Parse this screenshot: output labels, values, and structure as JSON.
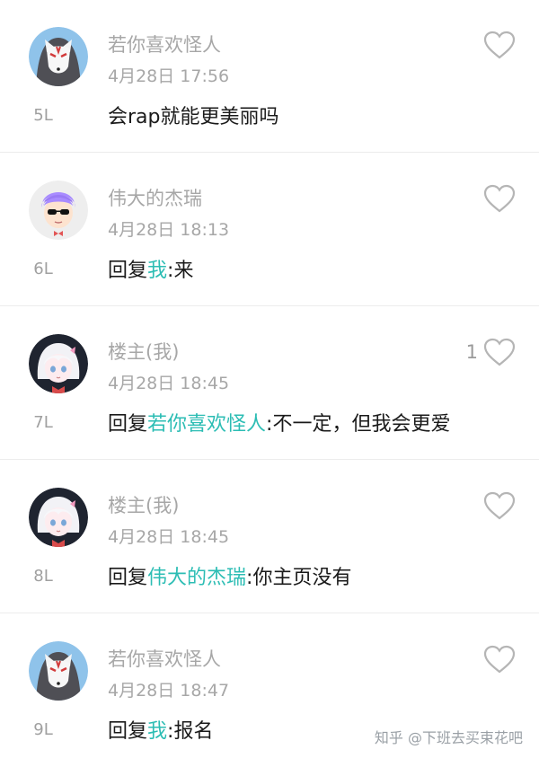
{
  "comments": [
    {
      "username": "若你喜欢怪人",
      "time": "4月28日 17:56",
      "floor": "5L",
      "reply_prefix": "",
      "mention": "",
      "separator": "",
      "text": "会rap就能更美丽吗",
      "like_count": "",
      "avatar": "fox-mask-avatar"
    },
    {
      "username": "伟大的杰瑞",
      "time": "4月28日 18:13",
      "floor": "6L",
      "reply_prefix": "回复",
      "mention": "我",
      "separator": ":",
      "text": "来",
      "like_count": "",
      "avatar": "sunglasses-boy-avatar"
    },
    {
      "username": "楼主(我)",
      "time": "4月28日 18:45",
      "floor": "7L",
      "reply_prefix": "回复",
      "mention": "若你喜欢怪人",
      "separator": ":",
      "text": "不一定，但我会更爱",
      "like_count": "1",
      "avatar": "white-hair-girl-avatar"
    },
    {
      "username": "楼主(我)",
      "time": "4月28日 18:45",
      "floor": "8L",
      "reply_prefix": "回复",
      "mention": "伟大的杰瑞",
      "separator": ":",
      "text": "你主页没有",
      "like_count": "",
      "avatar": "white-hair-girl-avatar"
    },
    {
      "username": "若你喜欢怪人",
      "time": "4月28日 18:47",
      "floor": "9L",
      "reply_prefix": "回复",
      "mention": "我",
      "separator": ":",
      "text": "报名",
      "like_count": "",
      "avatar": "fox-mask-avatar"
    }
  ],
  "watermark": "知乎 @下班去买束花吧",
  "colors": {
    "mention": "#2cbdb4",
    "meta_text": "#a7a7a7",
    "content_text": "#1a1a1a",
    "divider": "#ececec"
  },
  "icons": {
    "like": "heart-outline-icon"
  }
}
